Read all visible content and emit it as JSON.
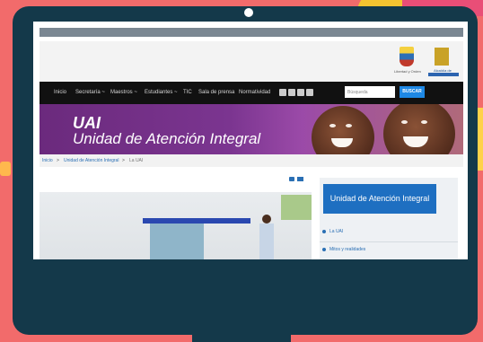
{
  "site": {
    "logo_left_caption": "Libertad y Orden",
    "logo_right_caption": "Alcaldía de Medellín",
    "nav": [
      "Inicio",
      "Secretaría ~",
      "Maestros ~",
      "Estudiantes ~",
      "TIC",
      "Sala de prensa",
      "Normatividad"
    ],
    "social_icons": [
      "twitter-icon",
      "facebook-icon",
      "youtube-icon",
      "instagram-icon"
    ],
    "search": {
      "placeholder": "Búsqueda",
      "button": "BUSCAR"
    },
    "banner": {
      "title": "UAI",
      "subtitle": "Unidad de Atención Integral"
    },
    "breadcrumb": [
      "Inicio",
      "Unidad de Atención Integral",
      "La UAI"
    ],
    "breadcrumb_separator": ">",
    "sidebar": {
      "heading": "Unidad de Atención Integral",
      "items": [
        "La UAI",
        "Mitos y realidades"
      ]
    }
  },
  "colors": {
    "background": "#f26b6b",
    "monitor": "#14394a",
    "navbar": "#111111",
    "accent": "#1e88e5",
    "banner": "#6b2a7d"
  }
}
